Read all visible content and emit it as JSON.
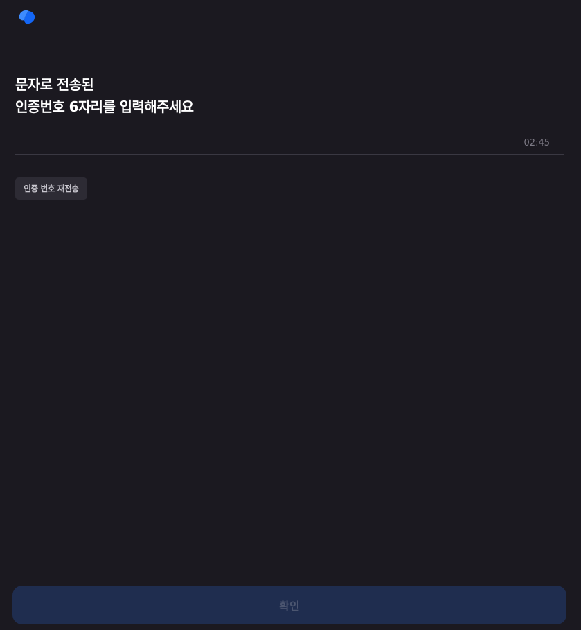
{
  "header": {
    "logo_icon": "brand-logo-icon",
    "logo_color": "#1a6bff"
  },
  "title": {
    "line1": "문자로 전송된",
    "line2": "인증번호 6자리를 입력해주세요"
  },
  "code_input": {
    "value": "",
    "placeholder": "",
    "timer": "02:45"
  },
  "resend_button": {
    "label": "인증 번호 재전송"
  },
  "confirm_button": {
    "label": "확인",
    "color": "#1f2d4f"
  }
}
